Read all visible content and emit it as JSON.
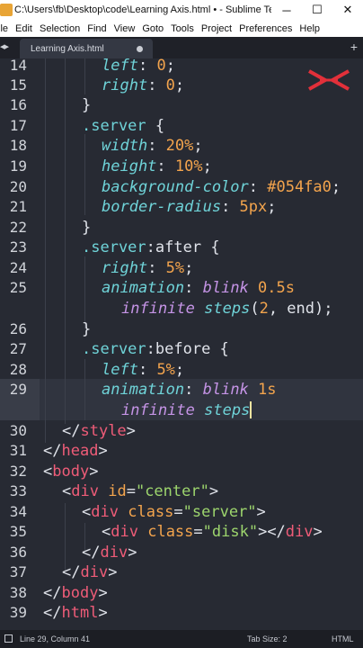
{
  "window": {
    "title": "C:\\Users\\fb\\Desktop\\code\\Learning Axis.html • - Sublime Text...",
    "minimize": "─",
    "maximize": "☐",
    "close": "✕"
  },
  "menu": [
    "ile",
    "Edit",
    "Selection",
    "Find",
    "View",
    "Goto",
    "Tools",
    "Project",
    "Preferences",
    "Help"
  ],
  "tab": {
    "name": "Learning Axis.html",
    "arrows": "◂▸",
    "add": "+"
  },
  "status": {
    "position": "Line 29, Column 41",
    "tab_size": "Tab Size: 2",
    "syntax": "HTML"
  },
  "line_numbers": [
    "14",
    "15",
    "16",
    "17",
    "18",
    "19",
    "20",
    "21",
    "22",
    "23",
    "24",
    "25",
    "26",
    "27",
    "28",
    "29",
    "30",
    "31",
    "32",
    "33",
    "34",
    "35",
    "36",
    "37",
    "38",
    "39"
  ],
  "current_line": "29",
  "code": {
    "l14": [
      "left",
      ": ",
      "0",
      ";"
    ],
    "l15": [
      "right",
      ": ",
      "0",
      ";"
    ],
    "l16": [
      "}"
    ],
    "l17": [
      ".server",
      " {"
    ],
    "l18": [
      "width",
      ": ",
      "20%",
      ";"
    ],
    "l19": [
      "height",
      ": ",
      "10%",
      ";"
    ],
    "l20": [
      "background-color",
      ": ",
      "#054fa0",
      ";"
    ],
    "l21": [
      "border-radius",
      ": ",
      "5px",
      ";"
    ],
    "l22": [
      "}"
    ],
    "l23": [
      ".server",
      ":after",
      " {"
    ],
    "l24": [
      "right",
      ": ",
      "5%",
      ";"
    ],
    "l25a": [
      "animation",
      ": ",
      "blink",
      " ",
      "0.5s"
    ],
    "l25b": [
      "infinite",
      " ",
      "steps",
      "(",
      "2",
      ", end);"
    ],
    "l26": [
      "}"
    ],
    "l27": [
      ".server",
      ":before",
      " {"
    ],
    "l28": [
      "left",
      ": ",
      "5%",
      ";"
    ],
    "l29a": [
      "animation",
      ": ",
      "blink",
      " ",
      "1s"
    ],
    "l29b": [
      "infinite",
      " ",
      "steps"
    ],
    "l30": [
      "</",
      "style",
      ">"
    ],
    "l31": [
      "</",
      "head",
      ">"
    ],
    "l32": [
      "<",
      "body",
      ">"
    ],
    "l33": [
      "<",
      "div",
      " ",
      "id",
      "=",
      "\"center\"",
      ">"
    ],
    "l34": [
      "<",
      "div",
      " ",
      "class",
      "=",
      "\"server\"",
      ">"
    ],
    "l35": [
      "<",
      "div",
      " ",
      "class",
      "=",
      "\"disk\"",
      "></",
      "div",
      ">"
    ],
    "l36": [
      "</",
      "div",
      ">"
    ],
    "l37": [
      "</",
      "div",
      ">"
    ],
    "l38": [
      "</",
      "body",
      ">"
    ],
    "l39": [
      "</",
      "html",
      ">"
    ]
  },
  "colors": {
    "background": "#272a33",
    "tag": "#ef5c78",
    "property": "#6fd3d8",
    "value": "#f3a44d",
    "function": "#c594e6",
    "string": "#9dd56d"
  }
}
